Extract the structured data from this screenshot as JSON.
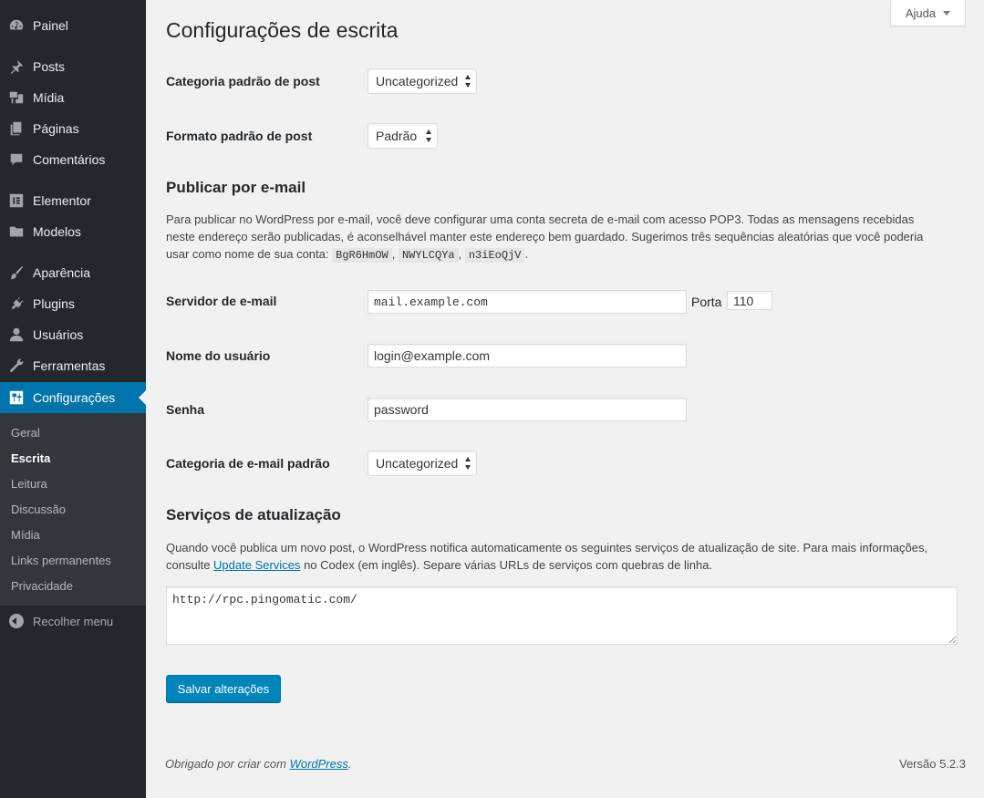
{
  "sidebar": {
    "items": [
      {
        "label": "Painel",
        "icon": "dashboard-icon"
      },
      {
        "label": "Posts",
        "icon": "pin-icon"
      },
      {
        "label": "Mídia",
        "icon": "media-icon"
      },
      {
        "label": "Páginas",
        "icon": "pages-icon"
      },
      {
        "label": "Comentários",
        "icon": "comment-icon"
      },
      {
        "label": "Elementor",
        "icon": "elementor-icon"
      },
      {
        "label": "Modelos",
        "icon": "folder-icon"
      },
      {
        "label": "Aparência",
        "icon": "brush-icon"
      },
      {
        "label": "Plugins",
        "icon": "plugin-icon"
      },
      {
        "label": "Usuários",
        "icon": "user-icon"
      },
      {
        "label": "Ferramentas",
        "icon": "wrench-icon"
      },
      {
        "label": "Configurações",
        "icon": "settings-icon",
        "current": true
      }
    ],
    "submenu": [
      "Geral",
      "Escrita",
      "Leitura",
      "Discussão",
      "Mídia",
      "Links permanentes",
      "Privacidade"
    ],
    "submenu_active": "Escrita",
    "collapse_label": "Recolher menu"
  },
  "help_tab": {
    "label": "Ajuda"
  },
  "page": {
    "title": "Configurações de escrita",
    "default_category": {
      "label": "Categoria padrão de post",
      "value": "Uncategorized"
    },
    "default_format": {
      "label": "Formato padrão de post",
      "value": "Padrão"
    },
    "post_by_email": {
      "title": "Publicar por e-mail",
      "desc_line1": "Para publicar no WordPress por e-mail, você deve configurar uma conta secreta de e-mail com acesso POP3. Todas as mensagens recebidas",
      "desc_line2": "neste endereço serão publicadas, é aconselhável manter este endereço bem guardado. Sugerimos três sequências aleatórias que você poderia",
      "desc_line3": "usar como nome de sua conta:",
      "keys": [
        "BgR6HmOW",
        "NWYLCQYa",
        "n3iEoQjV"
      ],
      "key_sep": ",",
      "end_period": "."
    },
    "mail_server": {
      "label": "Servidor de e-mail",
      "value": "mail.example.com",
      "port_label": "Porta",
      "port_value": "110"
    },
    "login": {
      "label": "Nome do usuário",
      "value": "login@example.com"
    },
    "password": {
      "label": "Senha",
      "value": "password"
    },
    "default_mail_category": {
      "label": "Categoria de e-mail padrão",
      "value": "Uncategorized"
    },
    "update_services": {
      "title": "Serviços de atualização",
      "desc_line1": "Quando você publica um novo post, o WordPress notifica automaticamente os seguintes serviços de atualização de site. Para mais informações,",
      "desc_pre_link": "consulte",
      "link": "Update Services",
      "desc_post_link": "no Codex (em inglês). Separe várias URLs de serviços com quebras de linha.",
      "value": "http://rpc.pingomatic.com/"
    },
    "save_button": "Salvar alterações"
  },
  "footer": {
    "thanks_pre": "Obrigado por criar com",
    "thanks_link": "WordPress",
    "thanks_post": ".",
    "version": "Versão 5.2.3"
  }
}
